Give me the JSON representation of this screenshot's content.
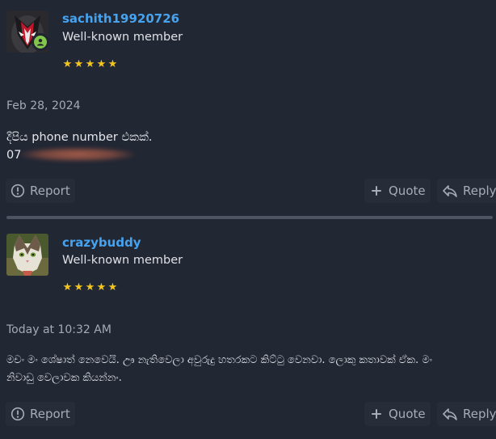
{
  "posts": [
    {
      "username": "sachith19920726",
      "user_title": "Well-known member",
      "stars": [
        "★",
        "★",
        "★",
        "★",
        "★"
      ],
      "date": "Feb 28, 2024",
      "body_line1": "දීපිය phone number එකක්.",
      "body_line2_prefix": "07",
      "actions": {
        "report": "Report",
        "quote": "Quote",
        "reply": "Reply"
      },
      "online": true
    },
    {
      "username": "crazybuddy",
      "user_title": "Well-known member",
      "stars": [
        "★",
        "★",
        "★",
        "★",
        "★"
      ],
      "date": "Today at 10:32 AM",
      "body_line1": "මචං මං ශේෂාත් නෙවෙයි. ඌ නැතිවෙලා අවුරුදු හතරකට කිට්ටු වෙනවා. ලොකු කතාවක් ඒක. මං",
      "body_line2": "නිවාඩු වෙලාවක කියන්නං.",
      "actions": {
        "report": "Report",
        "quote": "Quote",
        "reply": "Reply"
      },
      "online": false
    }
  ],
  "colors": {
    "background": "#222734",
    "username": "#46a3f0",
    "star": "#f4c51a",
    "online": "#83c64a",
    "divider": "#4e5361"
  },
  "icons": {
    "report": "exclamation-circle-icon",
    "quote": "plus-icon",
    "reply": "reply-arrow-icon",
    "online": "user-online-icon"
  }
}
